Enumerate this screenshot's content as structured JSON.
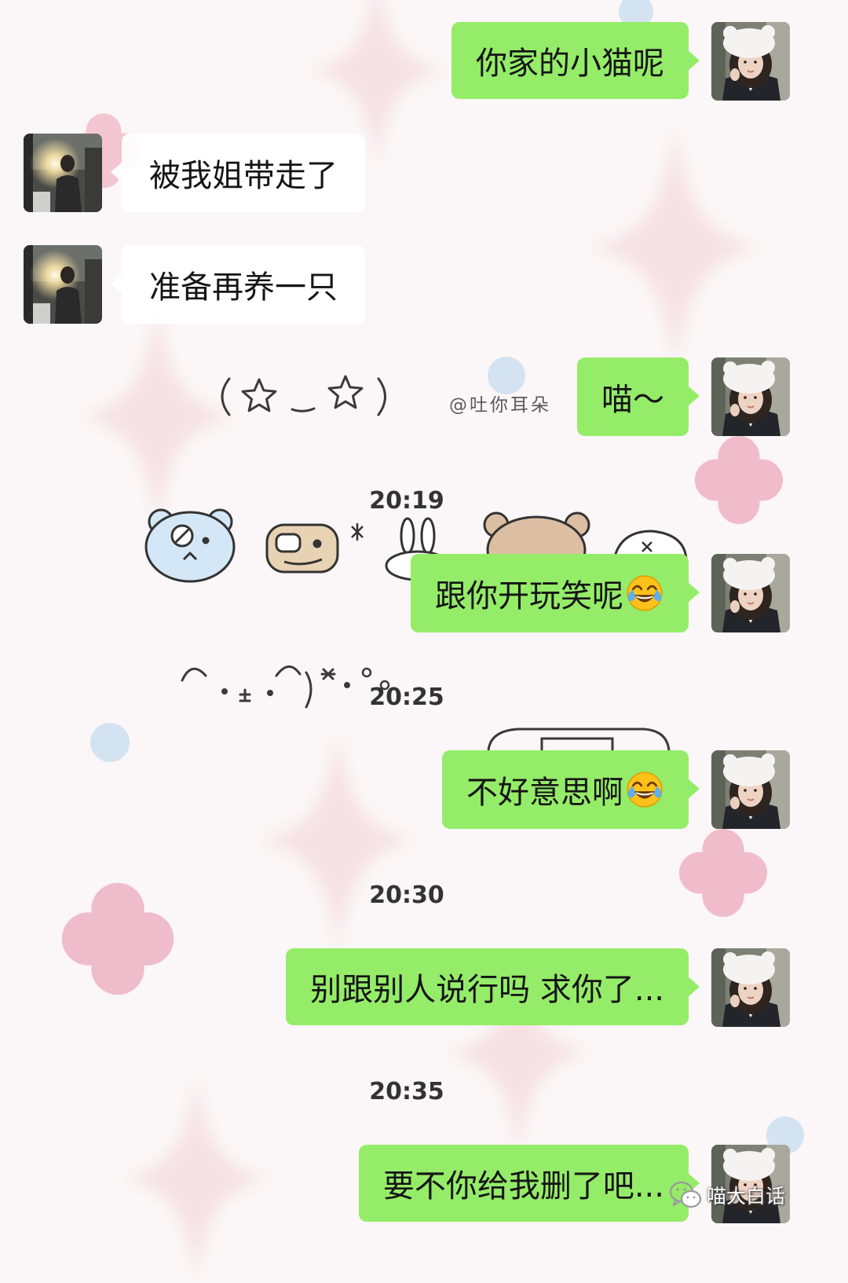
{
  "messages": [
    {
      "text": "你家的小猫呢",
      "bubble_color": "#95ec69",
      "avatar_icon": "avatar-girl-white-hat-icon"
    },
    {
      "text": "被我姐带走了",
      "bubble_color": "#ffffff",
      "avatar_icon": "avatar-sunlight-portrait-icon"
    },
    {
      "text": "准备再养一只",
      "bubble_color": "#ffffff",
      "avatar_icon": "avatar-sunlight-portrait-icon"
    },
    {
      "text": "喵～",
      "bubble_color": "#95ec69",
      "avatar_icon": "avatar-girl-white-hat-icon"
    },
    {
      "text": "跟你开玩笑呢",
      "emoji_icon": "face-with-tears-of-joy-icon",
      "bubble_color": "#95ec69",
      "avatar_icon": "avatar-girl-white-hat-icon"
    },
    {
      "text": "不好意思啊",
      "emoji_icon": "face-with-tears-of-joy-icon",
      "bubble_color": "#95ec69",
      "avatar_icon": "avatar-girl-white-hat-icon"
    },
    {
      "text": "别跟别人说行吗 求你了...",
      "bubble_color": "#95ec69",
      "avatar_icon": "avatar-girl-white-hat-icon"
    },
    {
      "text": "要不你给我删了吧...",
      "bubble_color": "#95ec69",
      "avatar_icon": "avatar-girl-white-hat-icon"
    }
  ],
  "timestamps": [
    "20:19",
    "20:25",
    "20:30",
    "20:35"
  ],
  "background": {
    "sticker_caption": "@吐你耳朵",
    "pink": "#f0bccb",
    "blue": "#d3e3f2"
  },
  "watermark": {
    "icon": "wechat-icon",
    "text": "喵大白话"
  }
}
